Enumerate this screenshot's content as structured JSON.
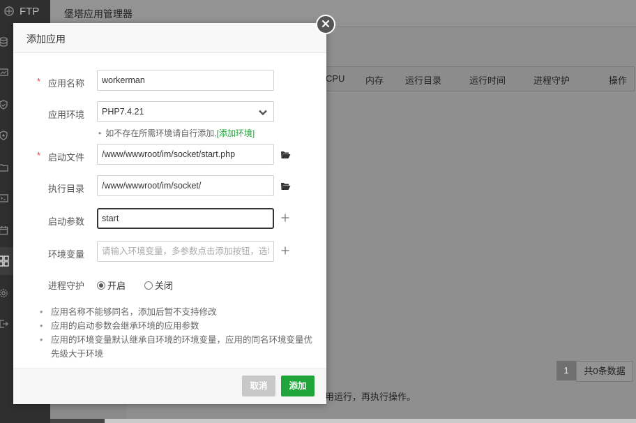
{
  "sidebar": {
    "items": [
      {
        "icon": "ftp-icon",
        "label": "FTP"
      },
      {
        "icon": "database-icon",
        "label": ""
      },
      {
        "icon": "monitor-icon",
        "label": ""
      },
      {
        "icon": "shield-icon",
        "label": ""
      },
      {
        "icon": "security-shield-icon",
        "label": ""
      },
      {
        "icon": "folder-icon",
        "label": ""
      },
      {
        "icon": "terminal-icon",
        "label": ""
      },
      {
        "icon": "calendar-icon",
        "label": ""
      },
      {
        "icon": "apps-grid-icon",
        "label": ""
      },
      {
        "icon": "gear-icon",
        "label": ""
      },
      {
        "icon": "logout-icon",
        "label": ""
      }
    ]
  },
  "background": {
    "title": "堡塔应用管理器",
    "table_headers": [
      "CPU",
      "内存",
      "运行目录",
      "运行时间",
      "进程守护",
      "操作"
    ],
    "pager_current": "1",
    "pager_total": "共0条数据",
    "tip": "用运行，再执行操作。"
  },
  "dialog": {
    "title": "添加应用",
    "fields": {
      "name": {
        "label": "应用名称",
        "value": "workerman",
        "required": "*"
      },
      "env": {
        "label": "应用环境",
        "value": "PHP7.4.21"
      },
      "env_hint": "如不存在所需环境请自行添加,",
      "env_hint_link": "[添加环境]",
      "start_file": {
        "label": "启动文件",
        "value": "/www/wwwroot/im/socket/start.php",
        "required": "*"
      },
      "exec_dir": {
        "label": "执行目录",
        "value": "/www/wwwroot/im/socket/"
      },
      "start_args": {
        "label": "启动参数",
        "value": "start"
      },
      "env_vars": {
        "label": "环境变量",
        "placeholder": "请输入环境变量，多参数点击添加按钮，选填"
      },
      "daemon": {
        "label": "进程守护",
        "on": "开启",
        "off": "关闭",
        "selected": "on"
      }
    },
    "notes": [
      "应用名称不能够同名，添加后暂不支持修改",
      "应用的启动参数会继承环境的应用参数",
      "应用的环境变量默认继承自环境的环境变量，应用的同名环境变量优先级大于环境"
    ],
    "buttons": {
      "cancel": "取消",
      "add": "添加"
    }
  },
  "colors": {
    "accent": "#20a53a",
    "required": "#e4393c"
  }
}
